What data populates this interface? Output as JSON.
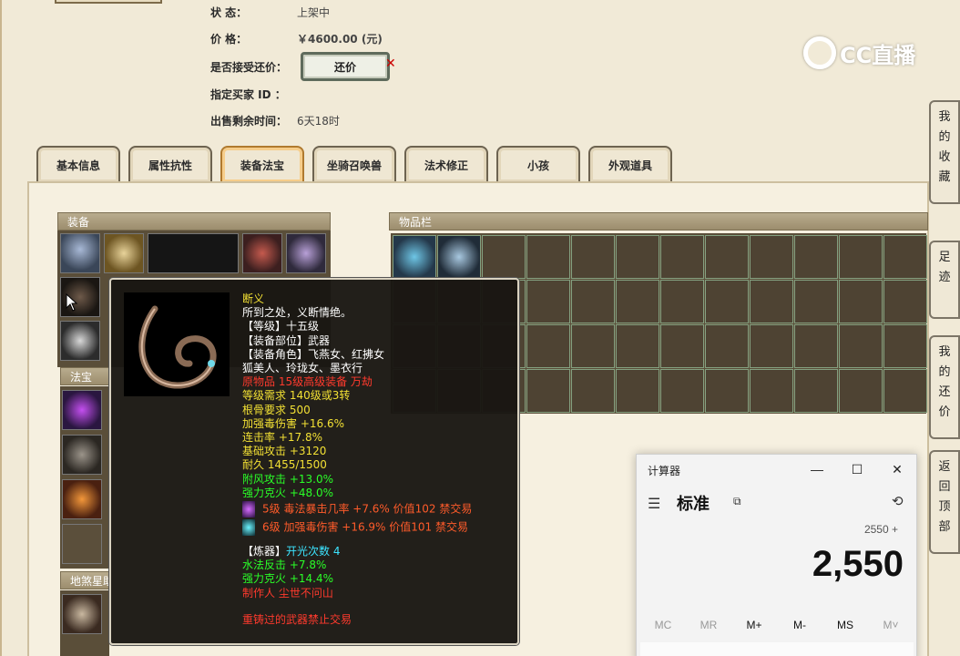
{
  "info": {
    "status_label": "状      态：",
    "status_value": "上架中",
    "price_label": "价      格：",
    "price_value": "￥4600.00 (元)",
    "counter_label": "是否接受还价：",
    "counter_button": "还价",
    "buyer_label": "指定买家 ID ：",
    "buyer_value": "",
    "time_label": "出售剩余时间：",
    "time_value": "6天18时"
  },
  "watermark": "CC直播",
  "tabs": [
    "基本信息",
    "属性抗性",
    "装备法宝",
    "坐骑召唤兽",
    "法术修正",
    "小孩",
    "外观道具"
  ],
  "active_tab": "装备法宝",
  "panels": {
    "equipment": "装备",
    "treasure": "法宝",
    "earth": "地煞星助",
    "inventory": "物品栏"
  },
  "tooltip": {
    "name": "断义",
    "desc": "所到之处，义断情绝。",
    "level": "【等级】十五级",
    "slot": "【装备部位】武器",
    "roles_line1": "【装备角色】飞燕女、红拂女",
    "roles_line2": "狐美人、玲珑女、墨衣行",
    "origin": "原物品 15级高级装备 万劫",
    "req": "等级需求 140级或3转",
    "bone": "根骨要求 500",
    "stat1": "加强毒伤害 +16.6%",
    "stat2": "连击率 +17.8%",
    "stat3": "基础攻击 +3120",
    "durability": "耐久 1455/1500",
    "stat4": "附风攻击 +13.0%",
    "stat5": "强力克火 +48.0%",
    "gem1": "5级 毒法暴击几率 +7.6% 价值102 禁交易",
    "gem2": "6级 加强毒伤害 +16.9% 价值101 禁交易",
    "refine_label": "【炼器】",
    "refine_value": "开光次数 4",
    "refine1": "水法反击 +7.8%",
    "refine2": "强力克火 +14.4%",
    "maker": "制作人 尘世不问山",
    "footer": "重铸过的武器禁止交易"
  },
  "sidebar": [
    "我的收藏",
    "足迹",
    "我的还价",
    "返回顶部"
  ],
  "calculator": {
    "title": "计算器",
    "mode": "标准",
    "expression": "2550 +",
    "display": "2,550",
    "memory": [
      "MC",
      "MR",
      "M+",
      "M-",
      "MS",
      "M˅"
    ]
  }
}
